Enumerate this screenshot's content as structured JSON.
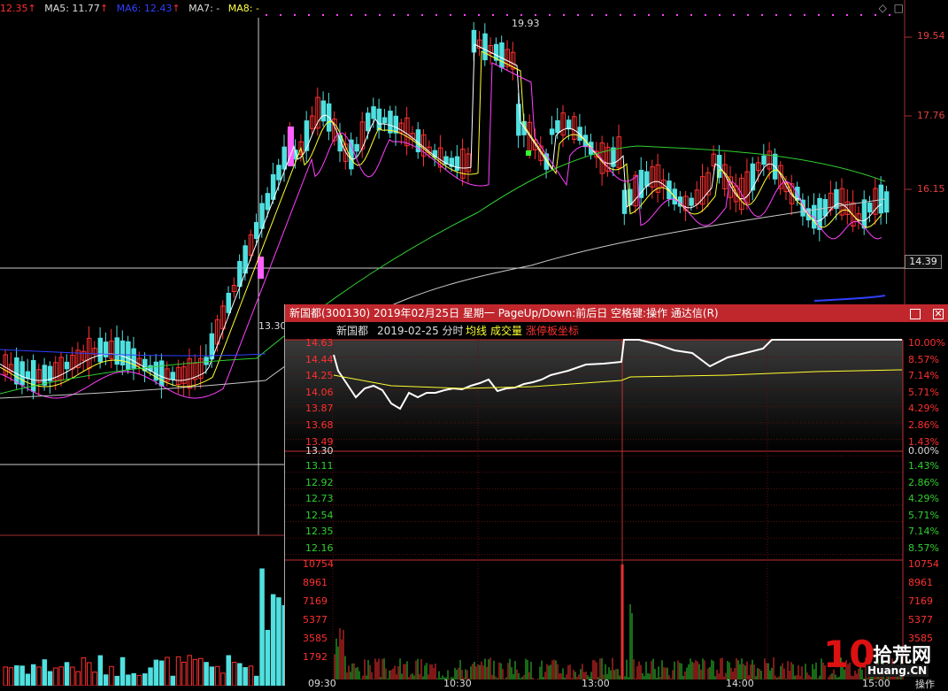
{
  "ma_bar": {
    "items": [
      {
        "label": "12.35",
        "arrow": "↑",
        "color": "#ff3030"
      },
      {
        "label": "MA5: 11.77",
        "arrow": "↑",
        "color": "#dddddd"
      },
      {
        "label": "MA6: 12.43",
        "arrow": "↑",
        "color": "#3040ff"
      },
      {
        "label": "MA7: -",
        "arrow": "",
        "color": "#dddddd"
      },
      {
        "label": "MA8: -",
        "arrow": "",
        "color": "#ffff40"
      }
    ]
  },
  "main_chart": {
    "price_axis": [
      "19.54",
      "17.76",
      "16.15"
    ],
    "current_price_box": "14.39",
    "high_label": "19.93",
    "cursor_price": "13.30",
    "colors": {
      "up": "#ff3030",
      "down": "#50e0e0",
      "ma_white": "#ffffff",
      "ma_yellow": "#ffff30",
      "ma_magenta": "#ff40ff",
      "ma_green": "#30d030",
      "ma_gray": "#c8c8c8"
    }
  },
  "popup": {
    "title": "新国都(300130) 2019年02月25日 星期一 PageUp/Down:前后日 空格键:操作 通达信(R)",
    "stock_name": "新国都",
    "date_label": "2019-02-25 分时",
    "legend": {
      "avg": "均线",
      "volume": "成交量",
      "limit_axis": "涨停板坐标"
    },
    "left_prices_up": [
      "14.63",
      "14.44",
      "14.25",
      "14.06",
      "13.87",
      "13.68",
      "13.49"
    ],
    "mid_price": "13.30",
    "left_prices_down": [
      "13.11",
      "12.92",
      "12.73",
      "12.54",
      "12.35",
      "12.16"
    ],
    "right_pcts_up": [
      "10.00%",
      "8.57%",
      "7.14%",
      "5.71%",
      "4.29%",
      "2.86%",
      "1.43%"
    ],
    "mid_pct": "0.00%",
    "right_pcts_down": [
      "1.43%",
      "2.86%",
      "4.29%",
      "5.71%",
      "7.14%",
      "8.57%"
    ],
    "volume_axis_left": [
      "10754",
      "8961",
      "7169",
      "5377",
      "3585",
      "1792"
    ],
    "volume_axis_right": [
      "10754",
      "8961",
      "7169",
      "5377",
      "3585"
    ],
    "time_labels": [
      "09:30",
      "10:30",
      "13:00",
      "14:00",
      "15:00"
    ],
    "corner_label": "操作"
  },
  "watermark": {
    "number": "10",
    "cn": "拾荒网",
    "en": "Huang.CN"
  }
}
